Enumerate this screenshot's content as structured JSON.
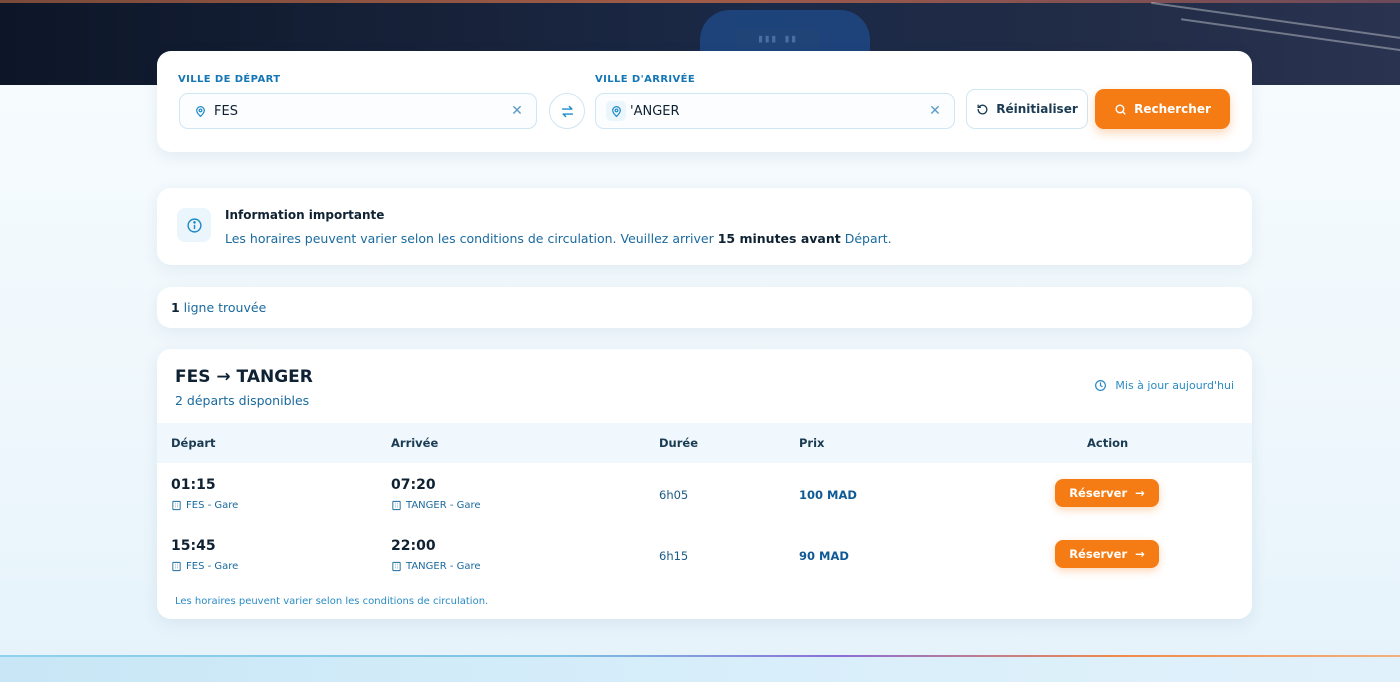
{
  "search": {
    "departure_label": "VILLE DE DÉPART",
    "departure_value": "FES",
    "arrival_label": "VILLE D'ARRIVÉE",
    "arrival_value": "'ANGER",
    "reset_label": "Réinitialiser",
    "search_label": "Rechercher"
  },
  "info": {
    "title": "Information importante",
    "text_prefix": "Les horaires peuvent varier selon les conditions de circulation. Veuillez arriver ",
    "text_bold": "15 minutes avant",
    "text_suffix": " Départ."
  },
  "results": {
    "count": "1",
    "count_label": " ligne trouvée"
  },
  "route": {
    "title": "FES → TANGER",
    "subtitle": "2 départs disponibles",
    "updated": "Mis à jour aujourd'hui",
    "columns": [
      "Départ",
      "Arrivée",
      "Durée",
      "Prix",
      "Action"
    ],
    "rows": [
      {
        "dep_time": "01:15",
        "dep_station": "FES - Gare",
        "arr_time": "07:20",
        "arr_station": "TANGER - Gare",
        "duration": "6h05",
        "price": "100 MAD",
        "action": "Réserver"
      },
      {
        "dep_time": "15:45",
        "dep_station": "FES - Gare",
        "arr_time": "22:00",
        "arr_station": "TANGER - Gare",
        "duration": "6h15",
        "price": "90 MAD",
        "action": "Réserver"
      }
    ],
    "note": "Les horaires peuvent varier selon les conditions de circulation."
  },
  "colors": {
    "accent": "#f57c14",
    "primary_blue": "#1576b6",
    "dark_text": "#0f2233"
  },
  "icons": {
    "pin": "map-pin-icon",
    "clear": "close-icon",
    "swap": "swap-arrows-icon",
    "reset": "refresh-icon",
    "search": "search-icon",
    "info": "info-icon",
    "clock": "clock-icon",
    "station": "building-icon",
    "arrow": "arrow-right-icon"
  }
}
